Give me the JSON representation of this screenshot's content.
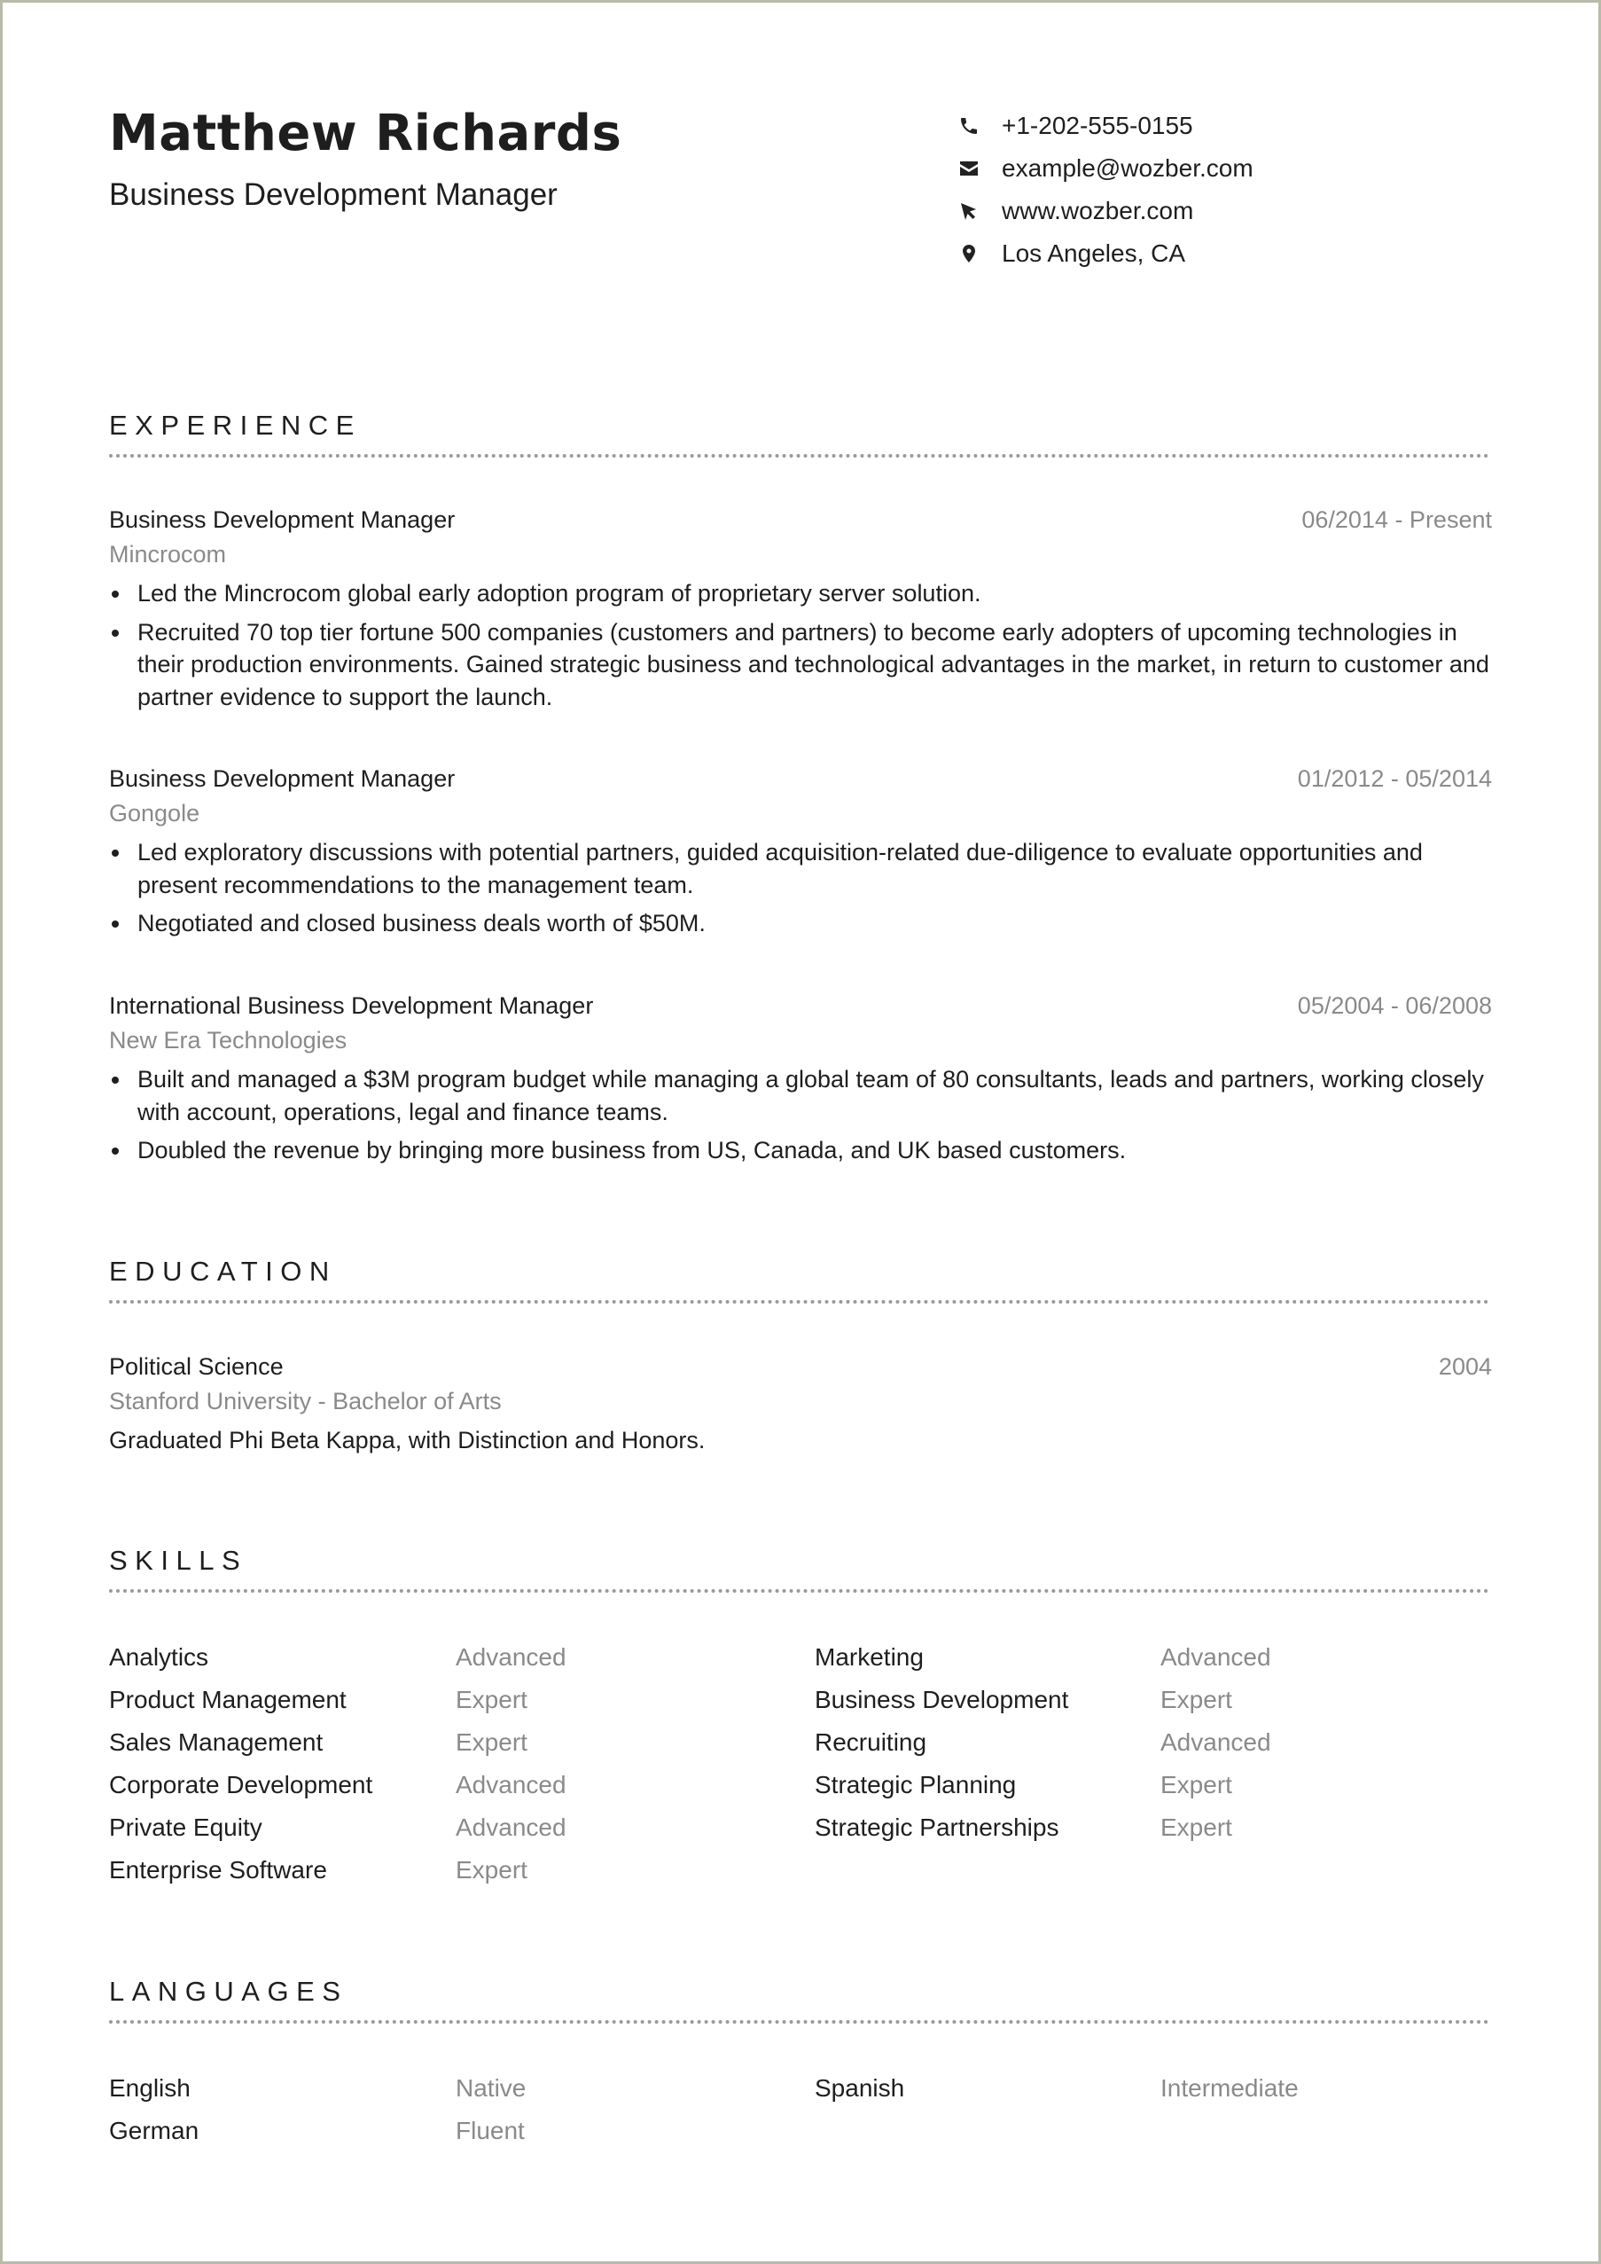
{
  "header": {
    "name": "Matthew Richards",
    "title": "Business Development Manager",
    "contacts": [
      {
        "icon": "phone-icon",
        "text": "+1-202-555-0155"
      },
      {
        "icon": "envelope-icon",
        "text": "example@wozber.com"
      },
      {
        "icon": "cursor-icon",
        "text": "www.wozber.com"
      },
      {
        "icon": "map-pin-icon",
        "text": "Los Angeles, CA"
      }
    ]
  },
  "experience": {
    "heading": "EXPERIENCE",
    "jobs": [
      {
        "title": "Business Development Manager",
        "company": "Mincrocom",
        "dates": "06/2014 - Present",
        "bullets": [
          "Led the Mincrocom global early adoption program of proprietary server solution.",
          "Recruited 70 top tier fortune 500 companies (customers and partners) to become early adopters of upcoming technologies in their production environments. Gained strategic business and technological advantages in the market, in return to customer and partner evidence to support the launch."
        ]
      },
      {
        "title": "Business Development Manager",
        "company": "Gongole",
        "dates": "01/2012 - 05/2014",
        "bullets": [
          "Led exploratory discussions with potential partners, guided acquisition-related due-diligence to evaluate opportunities and present recommendations to the management team.",
          "Negotiated and closed business deals worth of $50M."
        ]
      },
      {
        "title": "International Business Development Manager",
        "company": "New Era Technologies",
        "dates": "05/2004 - 06/2008",
        "bullets": [
          "Built and managed a $3M program budget while managing a global team of 80 consultants, leads and partners, working closely with account, operations, legal and finance teams.",
          "Doubled the revenue by bringing more business from US, Canada, and UK based customers."
        ]
      }
    ]
  },
  "education": {
    "heading": "EDUCATION",
    "items": [
      {
        "degree": "Political Science",
        "school": "Stanford University - Bachelor of Arts",
        "year": "2004",
        "description": "Graduated Phi Beta Kappa, with Distinction and Honors."
      }
    ]
  },
  "skills": {
    "heading": "SKILLS",
    "rows": [
      [
        {
          "name": "Analytics",
          "level": "Advanced"
        },
        {
          "name": "Marketing",
          "level": "Advanced"
        }
      ],
      [
        {
          "name": "Product Management",
          "level": "Expert"
        },
        {
          "name": "Business Development",
          "level": "Expert"
        }
      ],
      [
        {
          "name": "Sales Management",
          "level": "Expert"
        },
        {
          "name": "Recruiting",
          "level": "Advanced"
        }
      ],
      [
        {
          "name": "Corporate Development",
          "level": "Advanced"
        },
        {
          "name": "Strategic Planning",
          "level": "Expert"
        }
      ],
      [
        {
          "name": "Private Equity",
          "level": "Advanced"
        },
        {
          "name": "Strategic Partnerships",
          "level": "Expert"
        }
      ],
      [
        {
          "name": "Enterprise Software",
          "level": "Expert"
        },
        {
          "name": "",
          "level": ""
        }
      ]
    ]
  },
  "languages": {
    "heading": "LANGUAGES",
    "rows": [
      [
        {
          "name": "English",
          "level": "Native"
        },
        {
          "name": "Spanish",
          "level": "Intermediate"
        }
      ],
      [
        {
          "name": "German",
          "level": "Fluent"
        },
        {
          "name": "",
          "level": ""
        }
      ]
    ]
  },
  "colors": {
    "text": "#1e1e1e",
    "muted": "#8a8a8a",
    "rule": "#9a9a9a",
    "frame": "#b9bba9"
  }
}
